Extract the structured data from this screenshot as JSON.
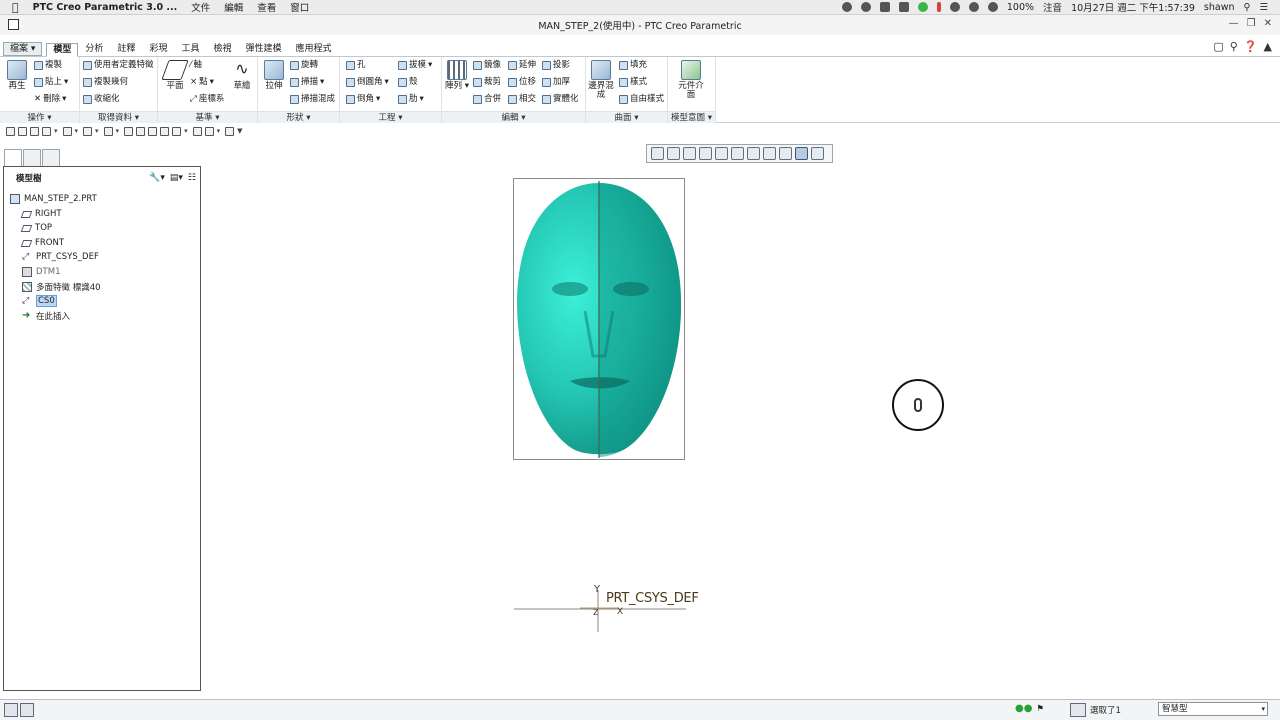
{
  "menubar": {
    "app_name": "PTC Creo Parametric 3.0 ...",
    "menus": [
      "文件",
      "編輯",
      "查看",
      "窗口"
    ],
    "battery": "100%",
    "input_method": "注音",
    "clock": "10月27日 週二 下午1:57:39",
    "user": "shawn"
  },
  "window": {
    "title": "MAN_STEP_2(使用中) - PTC Creo Parametric"
  },
  "ribbon": {
    "file_tab": "檔案",
    "tabs": [
      "模型",
      "分析",
      "註釋",
      "彩現",
      "工具",
      "檢視",
      "彈性建模",
      "應用程式"
    ],
    "groups": {
      "operations": {
        "label": "操作",
        "regenerate": "再生",
        "copy": "複製",
        "paste": "貼上",
        "delete": "刪除"
      },
      "get_data": {
        "label": "取得資料",
        "user_defined_feature": "使用者定義特徵",
        "copy_geometry": "複製幾何",
        "shrinkwrap": "收縮化"
      },
      "datum": {
        "label": "基準",
        "plane": "平面",
        "axis": "軸",
        "point": "點",
        "csys": "座標系",
        "sketch": "草繪"
      },
      "shapes": {
        "label": "形狀",
        "extrude": "拉伸",
        "revolve": "旋轉",
        "sweep": "掃描",
        "swept_blend": "掃描混成"
      },
      "engineering": {
        "label": "工程",
        "hole": "孔",
        "draft": "拔模",
        "round": "倒圓角",
        "shell": "殼",
        "chamfer": "倒角",
        "rib": "肋"
      },
      "editing": {
        "label": "編輯",
        "pattern": "陣列",
        "mirror": "鏡像",
        "extend": "延伸",
        "project": "投影",
        "trim": "裁剪",
        "offset": "位移",
        "thicken": "加厚",
        "merge": "合併",
        "intersect": "相交",
        "solidify": "實體化"
      },
      "surfaces": {
        "label": "曲面",
        "boundary_blend": "邊界混成",
        "fill": "填充",
        "style": "樣式",
        "freestyle": "自由樣式"
      },
      "model_intent": {
        "label": "模型意圖",
        "component_interface": "元件介面"
      }
    }
  },
  "model_tree": {
    "header": "模型樹",
    "root": "MAN_STEP_2.PRT",
    "items": [
      {
        "label": "RIGHT",
        "icon": "datum-plane-icon"
      },
      {
        "label": "TOP",
        "icon": "datum-plane-icon"
      },
      {
        "label": "FRONT",
        "icon": "datum-plane-icon"
      },
      {
        "label": "PRT_CSYS_DEF",
        "icon": "csys-icon"
      },
      {
        "label": "DTM1",
        "icon": "datum-plane-icon"
      },
      {
        "label": "多面特徵 標識40",
        "icon": "facet-feature-icon"
      },
      {
        "label": "CS0",
        "icon": "csys-icon",
        "selected": true
      },
      {
        "label": "在此插入",
        "icon": "insert-here-icon"
      }
    ]
  },
  "graphics": {
    "csys_label": "PRT_CSYS_DEF",
    "axis_x": "X",
    "axis_y": "Y",
    "axis_z": "Z"
  },
  "statusbar": {
    "selection_count": "選取了1",
    "filter_value": "智慧型"
  }
}
